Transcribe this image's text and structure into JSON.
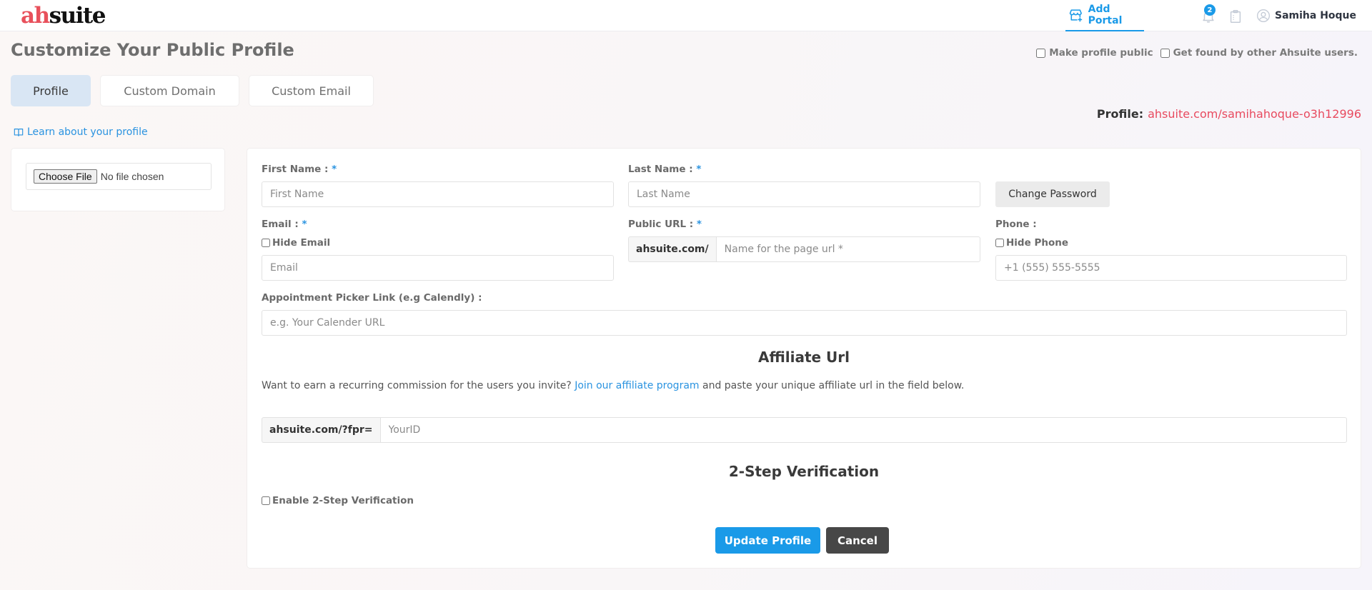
{
  "header": {
    "logo_prefix": "ah",
    "logo_suffix": "suite",
    "add_portal_label": "Add Portal",
    "notification_count": "2",
    "user_name": "Samiha Hoque"
  },
  "page": {
    "title": "Customize Your Public Profile",
    "make_public_label": "Make profile public",
    "get_found_label": "Get found by other Ahsuite users.",
    "profile_label": "Profile:",
    "profile_url": "ahsuite.com/samihahoque-o3h12996",
    "learn_link": "Learn about your profile"
  },
  "tabs": [
    {
      "label": "Profile",
      "active": true
    },
    {
      "label": "Custom Domain",
      "active": false
    },
    {
      "label": "Custom Email",
      "active": false
    }
  ],
  "upload": {
    "button_label": "Choose File",
    "status": "No file chosen"
  },
  "form": {
    "first_name": {
      "label": "First Name :",
      "required": "*",
      "placeholder": "First Name",
      "value": ""
    },
    "last_name": {
      "label": "Last Name :",
      "required": "*",
      "placeholder": "Last Name",
      "value": ""
    },
    "change_password_label": "Change Password",
    "email": {
      "label": "Email :",
      "required": "*",
      "hide_label": "Hide Email",
      "placeholder": "Email",
      "value": ""
    },
    "public_url": {
      "label": "Public URL :",
      "required": "*",
      "prefix": "ahsuite.com/",
      "placeholder": "Name for the page url *",
      "value": ""
    },
    "phone": {
      "label": "Phone :",
      "hide_label": "Hide Phone",
      "placeholder": "+1 (555) 555-5555",
      "value": ""
    },
    "appointment": {
      "label": "Appointment Picker Link (e.g Calendly) :",
      "placeholder": "e.g. Your Calender URL",
      "value": ""
    },
    "affiliate": {
      "title": "Affiliate Url",
      "text_before": "Want to earn a recurring commission for the users you invite?",
      "link_text": "Join our affiliate program",
      "text_after": "and paste your unique affiliate url in the field below.",
      "prefix": "ahsuite.com/?fpr=",
      "placeholder": "YourID",
      "value": ""
    },
    "two_step": {
      "title": "2-Step Verification",
      "enable_label": "Enable 2-Step Verification"
    },
    "update_label": "Update Profile",
    "cancel_label": "Cancel"
  },
  "colors": {
    "accent": "#1a9ae8",
    "brand_red": "#e8505b",
    "active_tab": "#d9e6f4",
    "dark_button": "#474747"
  }
}
